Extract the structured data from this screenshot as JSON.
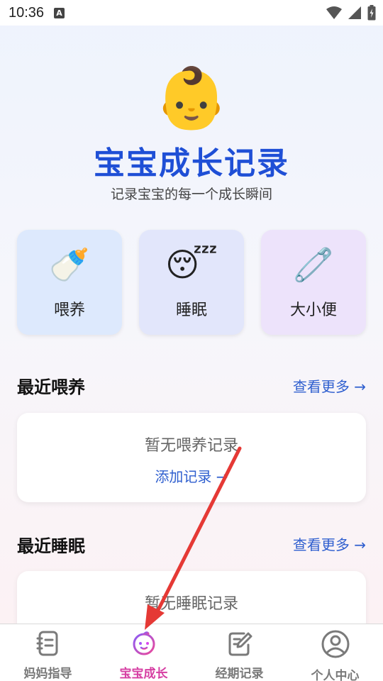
{
  "status_bar": {
    "time": "10:36",
    "notification_icon": "A"
  },
  "header": {
    "emoji": "👶",
    "title": "宝宝成长记录",
    "subtitle": "记录宝宝的每一个成长瞬间"
  },
  "categories": [
    {
      "emoji": "🍼",
      "label": "喂养",
      "color": "#dde9fd"
    },
    {
      "emoji": "😴",
      "label": "睡眠",
      "color": "#e2e6fb"
    },
    {
      "emoji": "🧷",
      "label": "大小便",
      "color": "#ede3fb"
    }
  ],
  "feeding_section": {
    "title": "最近喂养",
    "more": "查看更多 →",
    "empty_text": "暂无喂养记录",
    "add_text": "添加记录 →"
  },
  "sleep_section": {
    "title": "最近睡眠",
    "more": "查看更多 →",
    "empty_text": "暂无睡眠记录"
  },
  "bottom_nav": [
    {
      "label": "妈妈指导",
      "icon": "notebook-icon",
      "active": false
    },
    {
      "label": "宝宝成长",
      "icon": "baby-face-icon",
      "active": true
    },
    {
      "label": "经期记录",
      "icon": "edit-note-icon",
      "active": false
    },
    {
      "label": "个人中心",
      "icon": "user-circle-icon",
      "active": false
    }
  ],
  "colors": {
    "title_blue": "#1f4fd6",
    "link_blue": "#2f5fcf",
    "active_pink": "#d63fa3",
    "arrow_red": "#e53935"
  }
}
